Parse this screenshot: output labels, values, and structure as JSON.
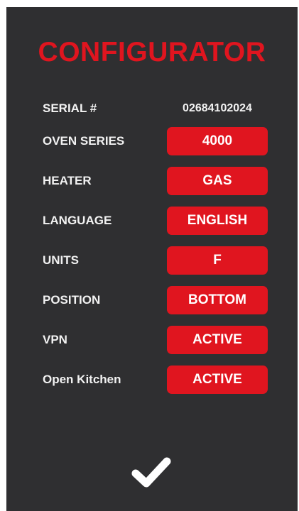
{
  "title": "CONFIGURATOR",
  "colors": {
    "background": "#2f2f31",
    "accent": "#e0151f",
    "text": "#f2f2f2"
  },
  "serial": {
    "label": "SERIAL #",
    "value": "02684102024"
  },
  "settings": [
    {
      "label": "OVEN SERIES",
      "value": "4000"
    },
    {
      "label": "HEATER",
      "value": "GAS"
    },
    {
      "label": "LANGUAGE",
      "value": "ENGLISH"
    },
    {
      "label": "UNITS",
      "value": "F"
    },
    {
      "label": "POSITION",
      "value": "BOTTOM"
    },
    {
      "label": "VPN",
      "value": "ACTIVE"
    },
    {
      "label": "Open Kitchen",
      "value": "ACTIVE"
    }
  ],
  "confirm": {
    "icon": "checkmark-icon"
  }
}
